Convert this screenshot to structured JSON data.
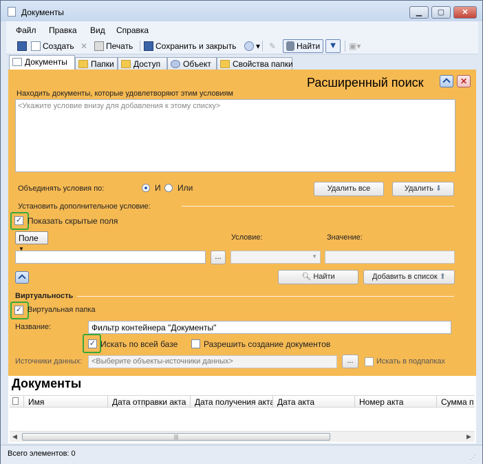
{
  "window": {
    "title": "Документы"
  },
  "menu": [
    "Файл",
    "Правка",
    "Вид",
    "Справка"
  ],
  "toolbar": {
    "create": "Создать",
    "print": "Печать",
    "save_close": "Сохранить и закрыть",
    "find": "Найти"
  },
  "tabs": [
    "Документы",
    "Папки",
    "Доступ",
    "Объект",
    "Свойства папки"
  ],
  "search": {
    "title": "Расширенный поиск",
    "find_docs_label": "Находить документы, которые удовлетворяют этим условиям",
    "conditions_placeholder": "<Укажите условие внизу для добавления к этому списку>",
    "combine_label": "Объединять условия по:",
    "radio_and": "И",
    "radio_or": "Или",
    "delete_all": "Удалить все",
    "delete": "Удалить",
    "additional_condition": "Установить дополнительное условие:",
    "show_hidden": "Показать скрытые поля",
    "field_dropdown": "Поле",
    "condition_label": "Условие:",
    "value_label": "Значение:",
    "browse": "...",
    "find_button": "Найти",
    "add_to_list": "Добавить в список"
  },
  "virtual": {
    "heading": "Виртуальность",
    "virtual_folder": "Виртуальная папка",
    "name_label": "Название:",
    "name_value": "Фильтр контейнера \"Документы\"",
    "search_all": "Искать по всей базе",
    "allow_create": "Разрешить создание документов",
    "sources_label": "Источники данных:",
    "sources_placeholder": "<Выберите объекты-источники данных>",
    "browse": "...",
    "search_subfolders": "Искать в подпапках"
  },
  "documents": {
    "heading": "Документы",
    "columns": [
      "Имя",
      "Дата отправки акта",
      "Дата получения акта",
      "Дата акта",
      "Номер акта",
      "Сумма п"
    ]
  },
  "status": {
    "text": "Всего элементов: 0"
  },
  "colors": {
    "panel": "#f6ba53",
    "highlight": "#3aa83a"
  }
}
